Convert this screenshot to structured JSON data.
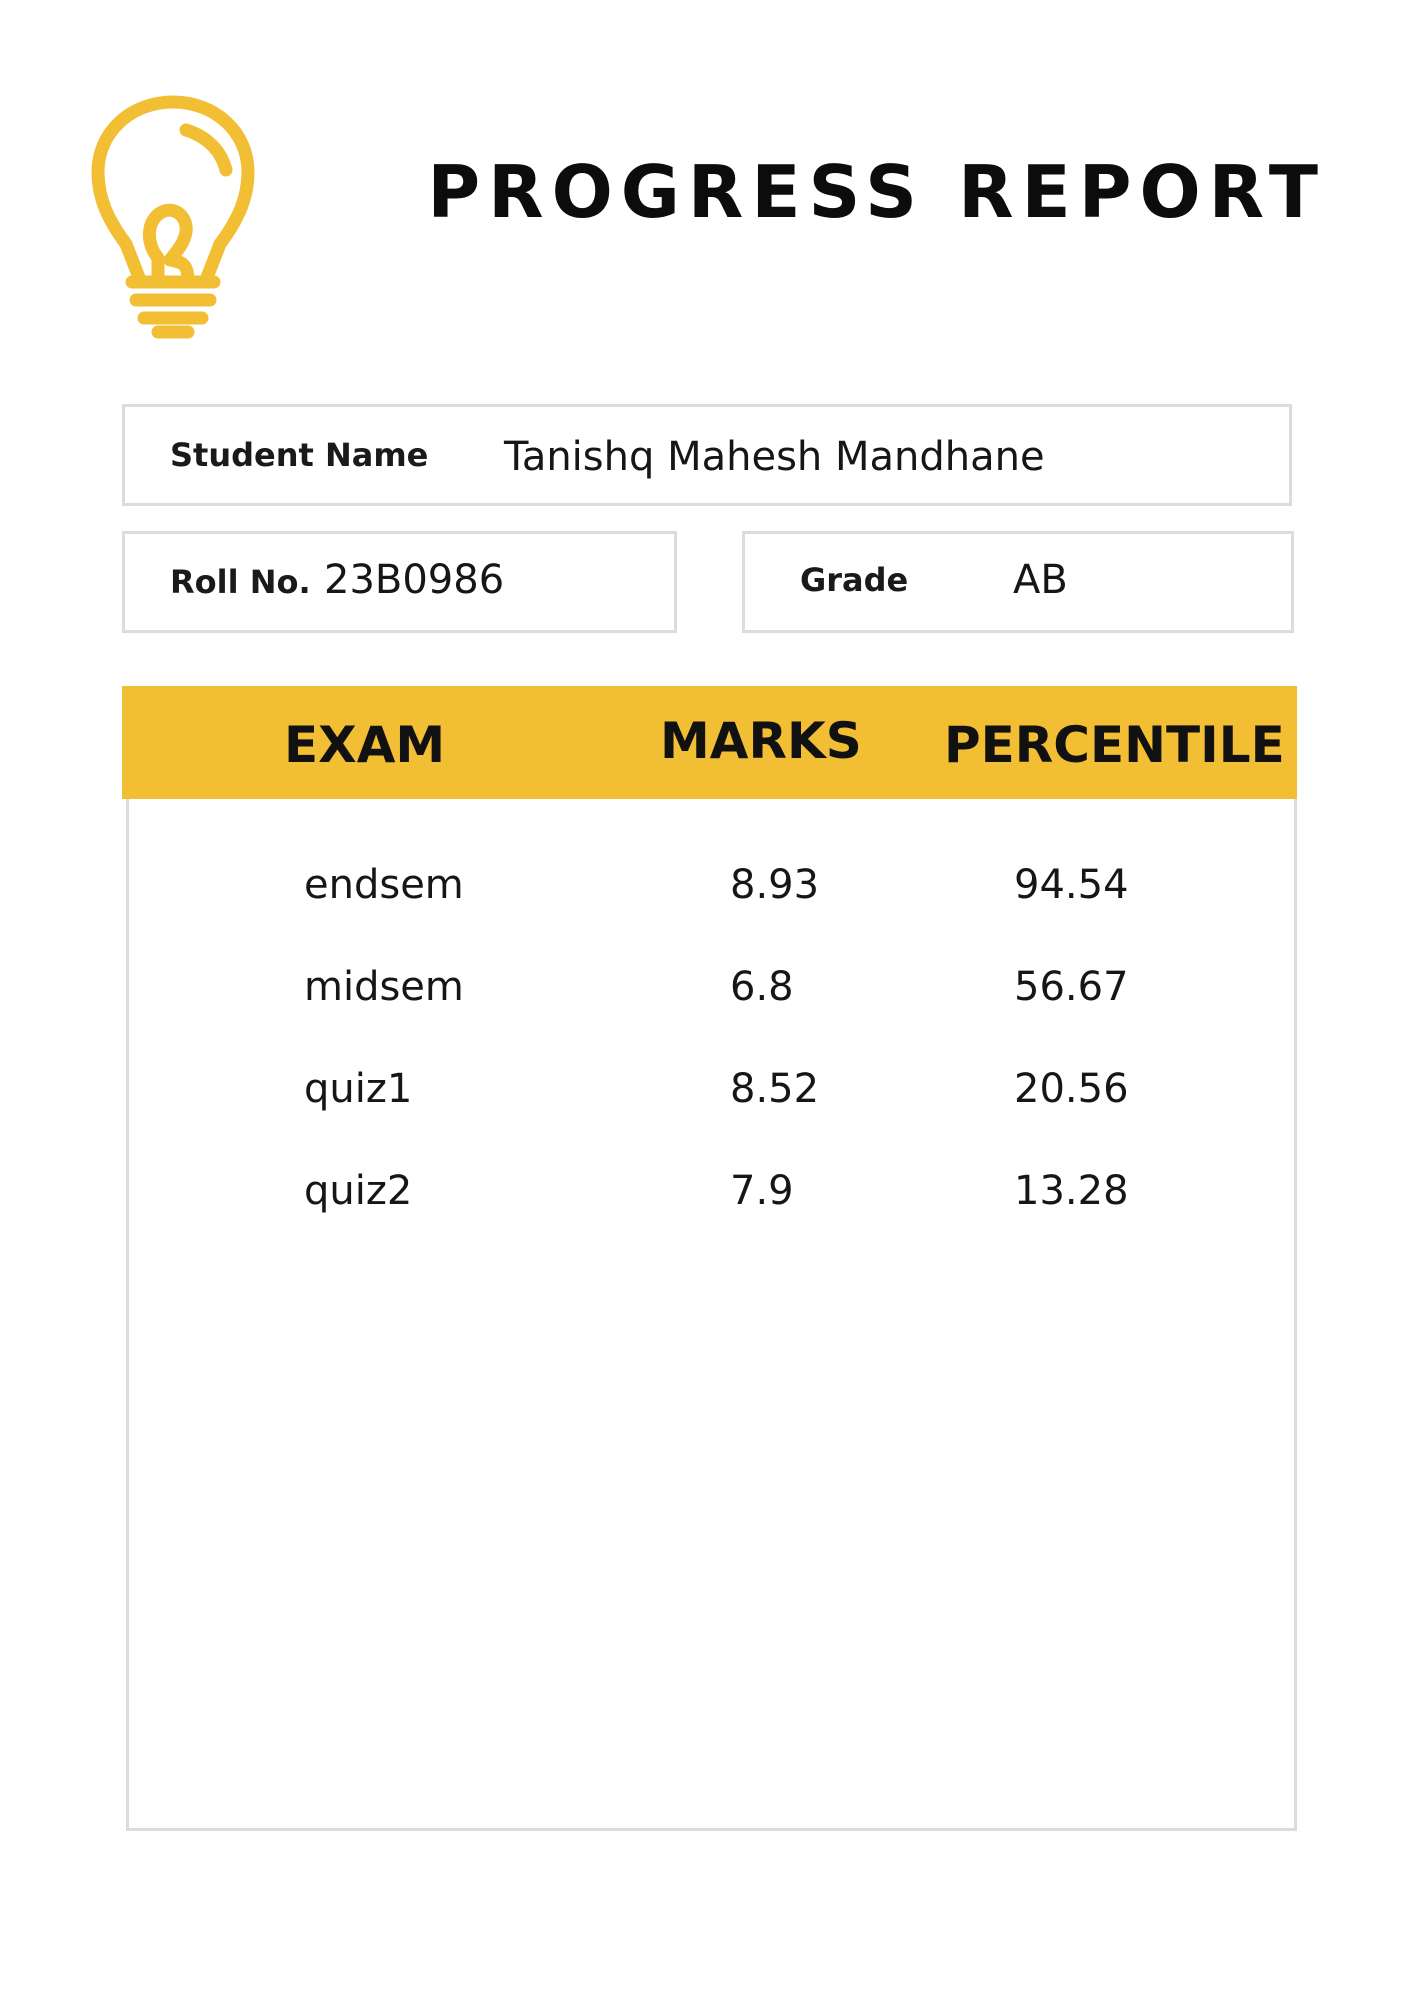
{
  "header": {
    "title": "PROGRESS REPORT",
    "icon": "lightbulb-icon",
    "accent_color": "#f2be34"
  },
  "student": {
    "name_label": "Student Name",
    "name_value": "Tanishq Mahesh Mandhane",
    "roll_label": "Roll No.",
    "roll_value": "23B0986",
    "grade_label": "Grade",
    "grade_value": "AB"
  },
  "table": {
    "headers": [
      "EXAM",
      "MARKS",
      "PERCENTILE"
    ],
    "rows": [
      [
        "endsem",
        "8.93",
        "94.54"
      ],
      [
        "midsem",
        "6.8",
        "56.67"
      ],
      [
        "quiz1",
        "8.52",
        "20.56"
      ],
      [
        "quiz2",
        "7.9",
        "13.28"
      ]
    ]
  }
}
